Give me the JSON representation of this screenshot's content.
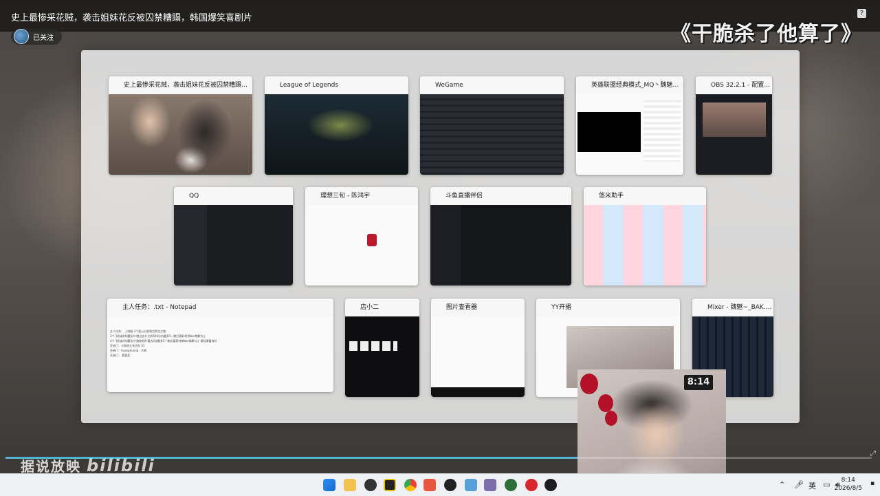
{
  "video": {
    "title": "史上最惨采花贼，袭击姐妹花反被囚禁糟蹋，韩国爆笑喜剧片",
    "caption": "《干脆杀了他算了》",
    "follow_label": "已关注",
    "help": "?",
    "watermark": "据说放映",
    "watermark_brand": "bilibili",
    "progress": 0.66
  },
  "windows": [
    {
      "title": "史上最惨采花贼，袭击姐妹花反被囚禁糟蹋，韩..."
    },
    {
      "title": "League of Legends"
    },
    {
      "title": "WeGame"
    },
    {
      "title": "英雄联盟经典模式_MQ丶魏魅摸..."
    },
    {
      "title": "OBS 32.2.1 - 配置文..."
    },
    {
      "title": "QQ"
    },
    {
      "title": "理想三旬 - 陈鸿宇"
    },
    {
      "title": "斗鱼直播伴侣"
    },
    {
      "title": "悠米助手"
    },
    {
      "title": "主人任务：.txt - Notepad"
    },
    {
      "title": "店小二"
    },
    {
      "title": "图片查看器"
    },
    {
      "title": "YY开播"
    },
    {
      "title": "Mixer - 魏魅~_BAK.VIP"
    }
  ],
  "notepad_lines": [
    "主人任务：  上电脑            3个星火分到到位到位大跑",
    "     2个飞机或8车魔法书    跑过去4-大帆500分内最多5一跑打喜好时到bar就静为止",
    "     4个飞机或4车魔法书    跑跑到8-喜去5加最多5一跑玩喜好时做bar就静为止 保险满值有时",
    "开始门：卡到很久充活办  X1",
    "开始门：huanghuang - 大帆",
    "开始门：  喜爱奖"
  ],
  "camera": {
    "clock": "8:14"
  },
  "taskbar": {
    "tray_lang": "英",
    "time": "8:14",
    "date": "2026/8/5",
    "apps": [
      "windows-start-icon",
      "file-explorer-icon",
      "app-icon-1",
      "app-icon-2",
      "chrome-icon",
      "app-icon-3",
      "qq-icon",
      "notepad-icon",
      "app-icon-4",
      "app-icon-5",
      "netease-music-icon",
      "app-icon-6"
    ]
  }
}
